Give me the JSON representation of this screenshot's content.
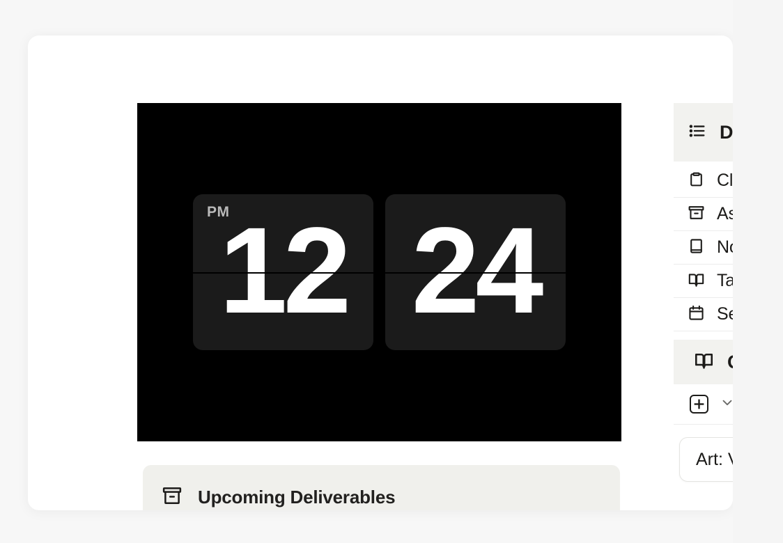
{
  "window": {
    "background_color": "#f7f7f7",
    "card_background": "#ffffff"
  },
  "clock_widget": {
    "name": "flip-clock",
    "background_color": "#000000",
    "card_color": "#1b1b1b",
    "meridiem": "PM",
    "hours": "12",
    "minutes": "24",
    "time_display": "12:24 PM"
  },
  "deliverables": {
    "icon": "archive-icon",
    "title": "Upcoming Deliverables",
    "background_color": "#f0f0ec"
  },
  "sidebar": {
    "header": {
      "icon": "list-icon",
      "label": "D"
    },
    "items": [
      {
        "icon": "clipboard-icon",
        "label": "Clas"
      },
      {
        "icon": "archive-icon",
        "label": "Ass"
      },
      {
        "icon": "book-closed-icon",
        "label": "Not"
      },
      {
        "icon": "book-open-icon",
        "label": "Tas"
      },
      {
        "icon": "calendar-icon",
        "label": "Sem"
      }
    ],
    "section": {
      "icon": "book-open-icon",
      "label": "C",
      "background_color": "#f2f2ef"
    },
    "toolbar": {
      "view_icon": "grid-view-icon",
      "chevron_icon": "chevron-down-icon"
    },
    "course_card": {
      "label": "Art: Vi"
    }
  }
}
